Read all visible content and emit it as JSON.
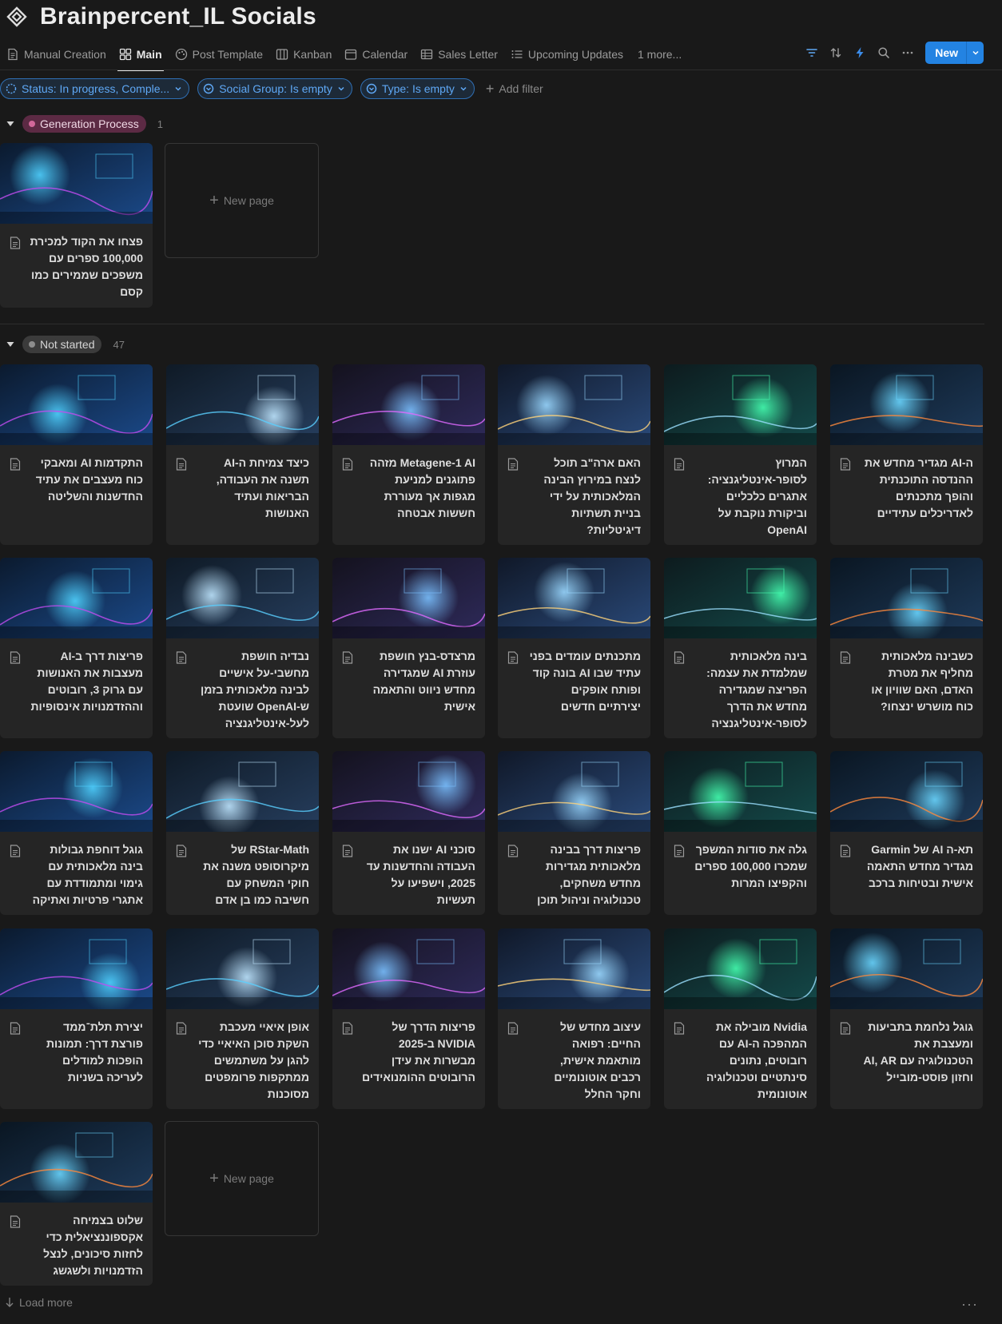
{
  "page": {
    "title": "Brainpercent_IL Socials"
  },
  "tabs": [
    {
      "label": "Manual Creation",
      "icon": "document-icon"
    },
    {
      "label": "Main",
      "icon": "gallery-icon",
      "active": true
    },
    {
      "label": "Post Template",
      "icon": "palette-icon"
    },
    {
      "label": "Kanban",
      "icon": "board-icon"
    },
    {
      "label": "Calendar",
      "icon": "calendar-icon"
    },
    {
      "label": "Sales Letter",
      "icon": "table-icon"
    },
    {
      "label": "Upcoming Updates",
      "icon": "list-icon"
    }
  ],
  "tabs_more": "1 more...",
  "toolbar": {
    "new_label": "New"
  },
  "filters": [
    {
      "label": "Status: In progress, Comple..."
    },
    {
      "label": "Social Group: Is empty"
    },
    {
      "label": "Type: Is empty"
    }
  ],
  "add_filter": "Add filter",
  "groups": [
    {
      "name": "Generation Process",
      "count": "1",
      "cards": [
        "פצחו את הקוד למכירת 100,000 ספרים עם משפכים שממירים כמו קסם"
      ],
      "new_page": "New page"
    },
    {
      "name": "Not started",
      "count": "47",
      "cards": [
        "ה-AI מגדיר מחדש את ההנדסה התוכנתית והופך מתכנתים לאדריכלים עתידיים",
        "המרוץ לסופר-אינטליגנציה: אתגרים כלכליים וביקורת נוקבת על OpenAI",
        "האם ארה\"ב תוכל לנצח במירוץ הבינה המלאכותית על ידי בניית תשתיות דיגיטליות?",
        "Metagene-1 AI מזהה פתוגנים למניעת מגפות אך מעוררת חששות אבטחה",
        "כיצד צמיחת ה-AI תשנה את העבודה, הבריאות ועתיד האנושות",
        "התקדמות AI ומאבקי כוח מעצבים את עתיד החדשנות והשליטה",
        "כשבינה מלאכותית מחליף את מטרת האדם, האם שוויון או כוח מושרש ינצחו?",
        "בינה מלאכותית שמלמדת את עצמה: הפריצה שמגדירה מחדש את הדרך לסופר-אינטליגנציה",
        "מתכנתים עומדים בפני עתיד שבו AI בונה קוד ופותח אופקים יצירתיים חדשים",
        "מרצדס-בנץ חושפת עוזרת AI שמגדירה מחדש ניווט והתאמה אישית",
        "נבדיה חושפת מחשבי-על אישיים לבינה מלאכותית בזמן ש-OpenAI שועטת לעל-אינטליגנציה",
        "פריצות דרך ב-AI מעצבות את האנושות עם גרוק 3, רובוטים וההזדמנויות אינסופיות",
        "תא-ה AI של Garmin מגדיר מחדש התאמה אישית ובטיחות ברכב",
        "גלה את סודות המשפך שמכרו 100,000 ספרים והקפיצו המרות",
        "פריצות דרך בבינה מלאכותית מגדירות מחדש משחקים, טכנולוגיה וניהול תוכן",
        "סוכני AI ישנו את העבודה והחדשנות עד 2025, וישפיעו על תעשיות",
        "RStar-Math של מיקרוסופט משנה את חוקי המשחק עם חשיבה כמו בן אדם",
        "גוגל דוחפת גבולות בינה מלאכותית עם גימוי ומתמודדת עם אתגרי פרטיות ואתיקה",
        "גוגל נלחמת בתביעות ומעצבת את הטכנולוגיה עם AI, AR וחזון פוסט-מובייל",
        "Nvidia מובילה את המהפכה ה-AI עם רובוטים, נתונים סינתטיים וטכנולוגיה אוטונומית",
        "עיצוב מחדש של החיים: רפואה מותאמת אישית, רכבים אוטונומיים וחקר החלל",
        "פריצות הדרך של NVIDIA ב-2025 מבשרות את עידן הרובוטים ההומנואידים",
        "אופן איאיי מעכבת השקת סוכן האיאיי כדי להגן על משתמשים ממתקפות פרומפטים מסוכנות",
        "יצירת תלת־ממד פורצת דרך: תמונות הופכות למודלים לעריכה בשניות",
        "שלוט בצמיחה אקספוננציאלית כדי לחזות סיכונים, לנצל הזדמנויות ולשגשג"
      ],
      "new_page": "New page"
    }
  ],
  "load_more": "Load more",
  "colors": {
    "accent": "#2383e2",
    "background": "#191919",
    "card": "#252525",
    "filter_blue": "#5fa8f5",
    "tag_pink": "#5c2a44"
  }
}
